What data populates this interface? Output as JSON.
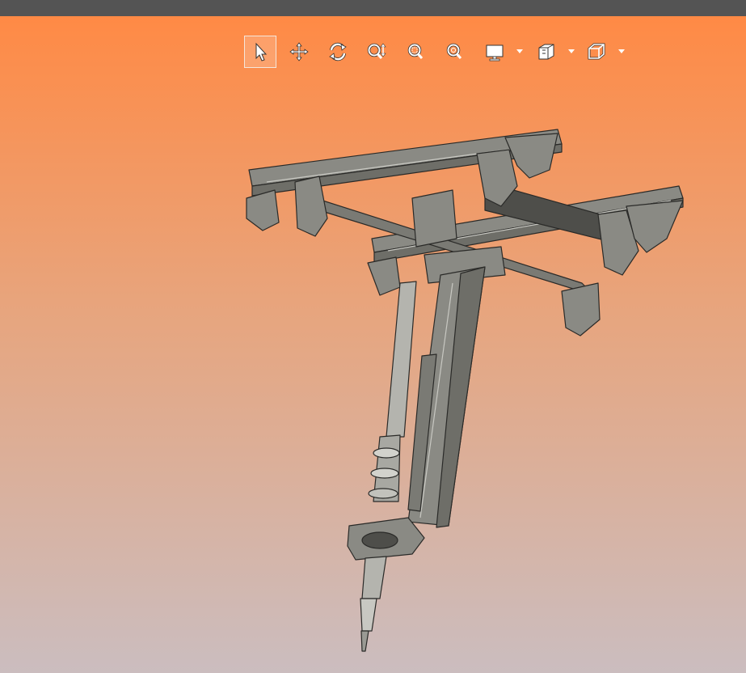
{
  "window": {
    "titlebar_color": "#545454"
  },
  "viewport": {
    "background_top": "#ff8a45",
    "background_bottom": "#cbbdbf",
    "model_color": "#8a8a84",
    "model_edge_color": "#2a2a28"
  },
  "toolbar": {
    "tools": [
      {
        "icon": "select-arrow-icon",
        "active": true
      },
      {
        "icon": "pan-move-icon",
        "active": false
      },
      {
        "icon": "rotate-icon",
        "active": false
      },
      {
        "icon": "zoom-updown-icon",
        "active": false
      },
      {
        "icon": "zoom-window-icon",
        "active": false
      },
      {
        "icon": "zoom-fit-icon",
        "active": false
      },
      {
        "icon": "display-monitor-icon",
        "has_dropdown": true
      },
      {
        "icon": "section-view-icon",
        "has_dropdown": true
      },
      {
        "icon": "view-cube-icon",
        "has_dropdown": true
      }
    ]
  }
}
